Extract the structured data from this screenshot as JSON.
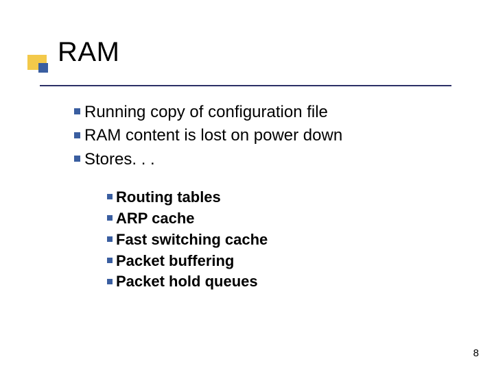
{
  "title": "RAM",
  "bullets_lvl1": [
    "Running copy of configuration file",
    "RAM content is lost on power down",
    "Stores. . ."
  ],
  "bullets_lvl2": [
    "Routing tables",
    "ARP cache",
    "Fast switching cache",
    "Packet buffering",
    "Packet hold queues"
  ],
  "page_number": "8"
}
